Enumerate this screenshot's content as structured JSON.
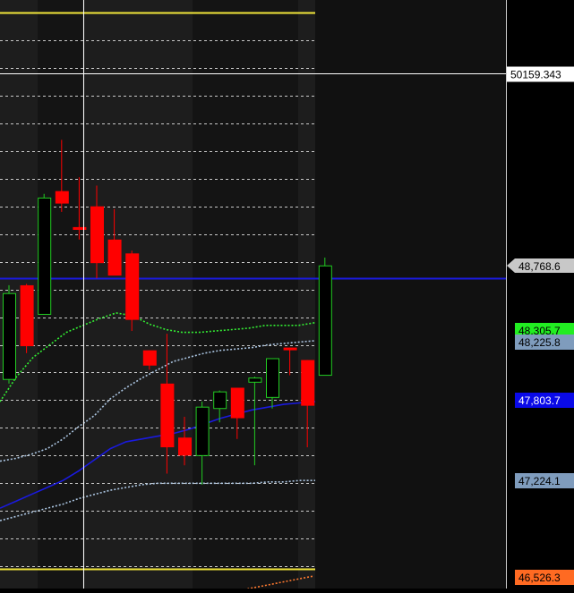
{
  "chart_data": {
    "type": "candlestick",
    "ylim": [
      46440,
      50690
    ],
    "price_cursor": {
      "value": 50159.343,
      "label": "50159.343"
    },
    "horizontal_levels": [
      {
        "value": 50600,
        "color": "#f2e63a"
      },
      {
        "value": 46580,
        "color": "#f2e63a"
      }
    ],
    "candles": [
      {
        "o": 48570,
        "h": 48630,
        "l": 47920,
        "c": 47950,
        "bull": true
      },
      {
        "o": 48630,
        "h": 48640,
        "l": 48140,
        "c": 48190,
        "bull": false
      },
      {
        "o": 48420,
        "h": 49290,
        "l": 48420,
        "c": 49260,
        "bull": true
      },
      {
        "o": 49310,
        "h": 49680,
        "l": 49160,
        "c": 49220,
        "bull": false
      },
      {
        "o": 49050,
        "h": 49410,
        "l": 48960,
        "c": 49030,
        "bull": false
      },
      {
        "o": 49200,
        "h": 49350,
        "l": 48680,
        "c": 48790,
        "bull": false
      },
      {
        "o": 48960,
        "h": 49180,
        "l": 48710,
        "c": 48700,
        "bull": false
      },
      {
        "o": 48860,
        "h": 48880,
        "l": 48300,
        "c": 48380,
        "bull": false
      },
      {
        "o": 48160,
        "h": 48160,
        "l": 48020,
        "c": 48050,
        "bull": false
      },
      {
        "o": 47920,
        "h": 48280,
        "l": 47270,
        "c": 47460,
        "bull": false
      },
      {
        "o": 47530,
        "h": 47680,
        "l": 47330,
        "c": 47400,
        "bull": false
      },
      {
        "o": 47400,
        "h": 47790,
        "l": 47190,
        "c": 47750,
        "bull": true
      },
      {
        "o": 47740,
        "h": 47870,
        "l": 47640,
        "c": 47860,
        "bull": true
      },
      {
        "o": 47890,
        "h": 47890,
        "l": 47520,
        "c": 47670,
        "bull": false
      },
      {
        "o": 47930,
        "h": 47970,
        "l": 47330,
        "c": 47960,
        "bull": true
      },
      {
        "o": 47820,
        "h": 48100,
        "l": 47740,
        "c": 48100,
        "bull": true
      },
      {
        "o": 48180,
        "h": 48180,
        "l": 47980,
        "c": 48180,
        "bull": false
      },
      {
        "o": 48090,
        "h": 48090,
        "l": 47460,
        "c": 47760,
        "bull": false
      },
      {
        "o": 47980,
        "h": 48830,
        "l": 47980,
        "c": 48770,
        "bull": true
      }
    ],
    "series": [
      {
        "color": "#33ee33",
        "dash": "2,2",
        "values": [
          47790,
          47970,
          48110,
          48200,
          48290,
          48340,
          48390,
          48430,
          48410,
          48350,
          48310,
          48290,
          48290,
          48300,
          48310,
          48320,
          48340,
          48340,
          48340,
          48360
        ]
      },
      {
        "color": "#aac4e0",
        "dash": "2,2",
        "values": [
          47360,
          47380,
          47410,
          47450,
          47520,
          47610,
          47690,
          47810,
          47890,
          47960,
          48020,
          48080,
          48110,
          48140,
          48160,
          48170,
          48180,
          48200,
          48210,
          48220,
          48230
        ]
      },
      {
        "color": "#1a1adf",
        "dash": "",
        "values": [
          47020,
          47070,
          47120,
          47170,
          47220,
          47290,
          47370,
          47450,
          47500,
          47520,
          47540,
          47560,
          47590,
          47630,
          47670,
          47700,
          47730,
          47750,
          47770,
          47780,
          47790
        ]
      },
      {
        "color": "#aac4e0",
        "dash": "2,2",
        "values": [
          46930,
          46960,
          46990,
          47020,
          47050,
          47090,
          47120,
          47150,
          47170,
          47190,
          47200,
          47200,
          47200,
          47200,
          47200,
          47200,
          47200,
          47210,
          47210,
          47220,
          47220
        ]
      },
      {
        "color": "#ff7a30",
        "dash": "2,2",
        "values": [
          46300,
          46320,
          46340,
          46360,
          46380,
          46400,
          46420,
          46440,
          46455,
          46470,
          46485,
          46500,
          46515,
          46530
        ]
      }
    ],
    "axis_labels": [
      {
        "label": "48,768.6",
        "value": 48768.6,
        "bg": "#c8c8c8",
        "fg": "#000000",
        "pointer": true
      },
      {
        "label": "48,305.7",
        "value": 48305.7,
        "bg": "#22ee22",
        "fg": "#000000",
        "pointer": false
      },
      {
        "label": "48,225.8",
        "value": 48225.8,
        "bg": "#7f9cbd",
        "fg": "#000000",
        "pointer": false
      },
      {
        "label": "47,803.7",
        "value": 47803.7,
        "bg": "#0a0ae8",
        "fg": "#ffffff",
        "pointer": false
      },
      {
        "label": "47,224.1",
        "value": 47224.1,
        "bg": "#7f9cbd",
        "fg": "#000000",
        "pointer": false
      },
      {
        "label": "46,526.3",
        "value": 46526.3,
        "bg": "#ff6a22",
        "fg": "#000000",
        "pointer": false
      }
    ],
    "colors": {
      "bull": "#22cc22",
      "bear": "#ff0000",
      "grid": "#e8e8e8",
      "background": "#141414",
      "axis_bg": "#000000"
    },
    "grid": true
  }
}
